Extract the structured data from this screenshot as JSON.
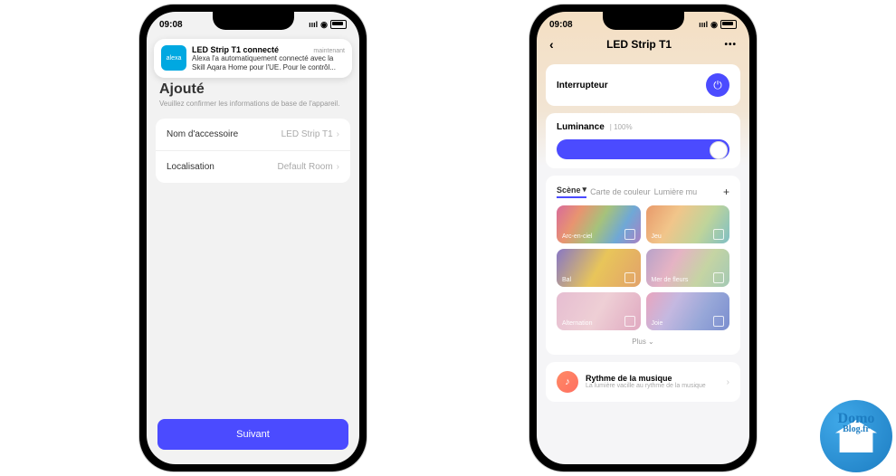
{
  "status": {
    "time": "09:08"
  },
  "phone1": {
    "notification": {
      "app": "alexa",
      "title": "LED Strip T1 connecté",
      "time": "maintenant",
      "body": "Alexa l'a automatiquement connecté avec la Skill Aqara Home pour l'UE. Pour le contrôl..."
    },
    "page_title": "Ajouté",
    "page_sub": "Veuillez confirmer les informations de base de l'appareil.",
    "rows": {
      "name": {
        "label": "Nom d'accessoire",
        "value": "LED Strip T1"
      },
      "location": {
        "label": "Localisation",
        "value": "Default Room"
      }
    },
    "next": "Suivant"
  },
  "phone2": {
    "title": "LED Strip T1",
    "switch": {
      "label": "Interrupteur"
    },
    "luminance": {
      "label": "Luminance",
      "value": "| 100%"
    },
    "tabs": {
      "scene": "Scène",
      "colorcard": "Carte de couleur",
      "music": "Lumière mu"
    },
    "scenes": {
      "arc": "Arc-en-ciel",
      "jeu": "Jeu",
      "bal": "Bal",
      "mer": "Mer de fleurs",
      "alt": "Alternation",
      "joie": "Joie"
    },
    "plus": "Plus ⌄",
    "music_rhythm": {
      "title": "Rythme de la musique",
      "sub": "La lumière vacille au rythme de la musique"
    }
  },
  "logo": {
    "line1": "Domo",
    "line2": "Blog.fr"
  }
}
